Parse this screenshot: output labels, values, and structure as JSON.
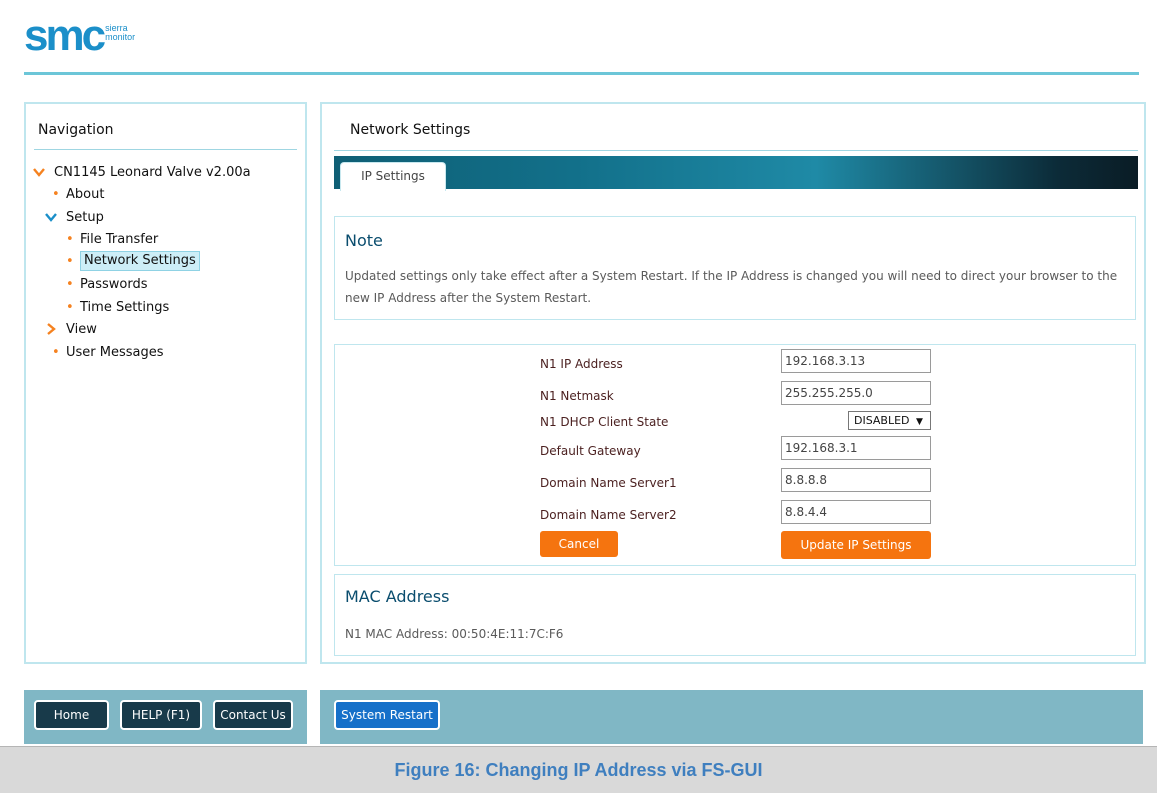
{
  "logo": {
    "brand": "smc",
    "sub_line1": "sierra",
    "sub_line2": "monitor"
  },
  "colors": {
    "accent": "#6cc6d8",
    "orange": "#f5740f",
    "dark_button": "#183a4a",
    "restart_button": "#1670c9",
    "footer_bar": "#80b7c5",
    "caption_text": "#3f7fbf"
  },
  "nav": {
    "title": "Navigation",
    "items": [
      {
        "label": "CN1145 Leonard Valve v2.00a",
        "icon": "chevron-down-icon"
      },
      {
        "label": "About",
        "icon": "bullet-icon"
      },
      {
        "label": "Setup",
        "icon": "chevron-down-icon"
      },
      {
        "label": "File Transfer",
        "icon": "bullet-icon"
      },
      {
        "label": "Network Settings",
        "icon": "bullet-icon",
        "selected": true
      },
      {
        "label": "Passwords",
        "icon": "bullet-icon"
      },
      {
        "label": "Time Settings",
        "icon": "bullet-icon"
      },
      {
        "label": "View",
        "icon": "chevron-right-icon"
      },
      {
        "label": "User Messages",
        "icon": "bullet-icon"
      }
    ]
  },
  "main": {
    "title": "Network Settings",
    "tabs": [
      {
        "label": "IP Settings",
        "active": true
      }
    ],
    "note": {
      "title": "Note",
      "text": "Updated settings only take effect after a System Restart. If the IP Address is changed you will need to direct your browser to the new IP Address after the System Restart."
    },
    "form": {
      "ip_label": "N1 IP Address",
      "ip_value": "192.168.3.13",
      "netmask_label": "N1 Netmask",
      "netmask_value": "255.255.255.0",
      "dhcp_label": "N1 DHCP Client State",
      "dhcp_value": "DISABLED",
      "gateway_label": "Default Gateway",
      "gateway_value": "192.168.3.1",
      "dns1_label": "Domain Name Server1",
      "dns1_value": "8.8.8.8",
      "dns2_label": "Domain Name Server2",
      "dns2_value": "8.8.4.4",
      "cancel_label": "Cancel",
      "update_label": "Update IP Settings"
    },
    "mac": {
      "title": "MAC Address",
      "line": "N1 MAC Address: 00:50:4E:11:7C:F6"
    }
  },
  "footer": {
    "home_label": "Home",
    "help_label": "HELP (F1)",
    "contact_label": "Contact Us",
    "restart_label": "System Restart"
  },
  "caption": "Figure 16: Changing IP Address via FS-GUI"
}
